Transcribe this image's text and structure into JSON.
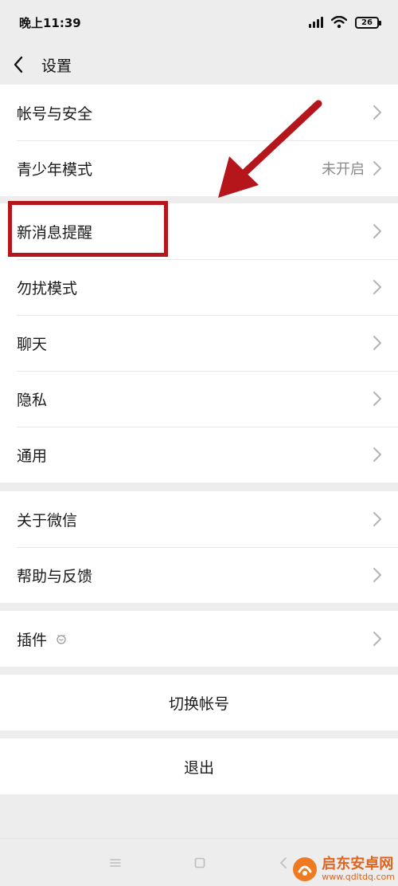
{
  "status_bar": {
    "time": "晚上11:39",
    "battery": "26",
    "icons": [
      "signal-icon",
      "wifi-icon",
      "battery-icon"
    ]
  },
  "nav": {
    "title": "设置",
    "back_icon": "back-arrow-icon"
  },
  "groups": [
    {
      "items": [
        {
          "label": "帐号与安全",
          "value": ""
        },
        {
          "label": "青少年模式",
          "value": "未开启"
        }
      ]
    },
    {
      "items": [
        {
          "label": "新消息提醒",
          "value": ""
        },
        {
          "label": "勿扰模式",
          "value": ""
        },
        {
          "label": "聊天",
          "value": ""
        },
        {
          "label": "隐私",
          "value": ""
        },
        {
          "label": "通用",
          "value": ""
        }
      ]
    },
    {
      "items": [
        {
          "label": "关于微信",
          "value": ""
        },
        {
          "label": "帮助与反馈",
          "value": ""
        }
      ]
    },
    {
      "items": [
        {
          "label": "插件",
          "value": ""
        }
      ]
    }
  ],
  "switch_account": "切换帐号",
  "logout": "退出",
  "annotation": {
    "highlight_color": "#b4161c",
    "target": "新消息提醒"
  },
  "system_nav": [
    "menu-icon",
    "home-icon",
    "back-icon"
  ],
  "watermark": {
    "title": "启东安卓网",
    "url": "www.qdltdq.com"
  },
  "colors": {
    "background": "#ededed",
    "card": "#ffffff",
    "secondary_text": "#8a8a8a",
    "annotation_red": "#b4161c"
  }
}
